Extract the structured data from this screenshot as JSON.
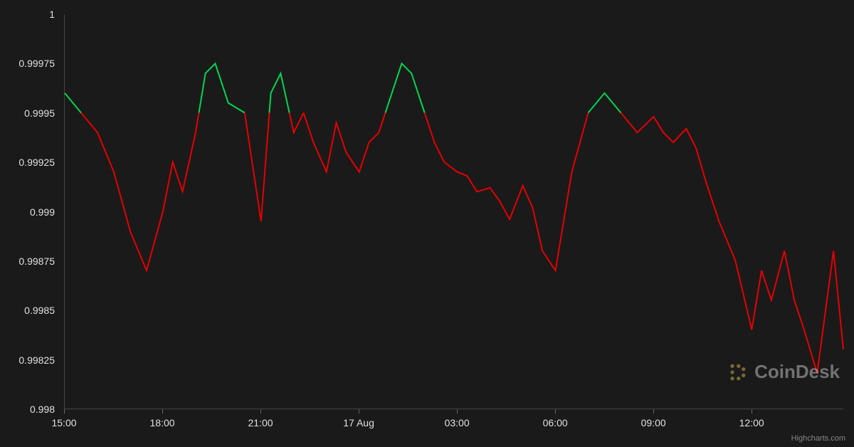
{
  "chart_data": {
    "type": "line",
    "title": "",
    "xlabel": "",
    "ylabel": "",
    "ylim": [
      0.998,
      1.0
    ],
    "x_ticks": [
      "15:00",
      "18:00",
      "21:00",
      "17 Aug",
      "03:00",
      "06:00",
      "09:00",
      "12:00"
    ],
    "y_ticks": [
      0.998,
      0.99825,
      0.9985,
      0.99875,
      0.999,
      0.99925,
      0.9995,
      0.99975,
      1.0
    ],
    "threshold": 0.9995,
    "color_above": "#00d64f",
    "color_below": "#e60000",
    "series": [
      {
        "name": "price",
        "x": [
          0,
          0.5,
          1,
          1.5,
          2,
          2.5,
          3,
          3.3,
          3.6,
          4,
          4.3,
          4.6,
          5,
          5.5,
          6,
          6.3,
          6.6,
          7,
          7.3,
          7.6,
          8,
          8.3,
          8.6,
          9,
          9.3,
          9.6,
          10,
          10.3,
          10.6,
          11,
          11.3,
          11.6,
          12,
          12.3,
          12.6,
          13,
          13.3,
          13.6,
          14,
          14.3,
          14.6,
          15,
          15.5,
          16,
          16.5,
          17,
          17.5,
          18,
          18.3,
          18.6,
          19,
          19.3,
          19.6,
          20,
          20.5,
          21,
          21.3,
          21.6,
          22,
          22.3,
          22.6,
          23,
          23.5,
          23.8
        ],
        "values": [
          0.9996,
          0.9995,
          0.9994,
          0.9992,
          0.9989,
          0.9987,
          0.999,
          0.99925,
          0.9991,
          0.9994,
          0.9997,
          0.99975,
          0.99955,
          0.9995,
          0.99895,
          0.9996,
          0.9997,
          0.9994,
          0.9995,
          0.99935,
          0.9992,
          0.99945,
          0.9993,
          0.9992,
          0.99935,
          0.9994,
          0.9996,
          0.99975,
          0.9997,
          0.9995,
          0.99935,
          0.99925,
          0.9992,
          0.99918,
          0.9991,
          0.99912,
          0.99905,
          0.99896,
          0.99913,
          0.99902,
          0.9988,
          0.9987,
          0.9992,
          0.9995,
          0.9996,
          0.9995,
          0.9994,
          0.99948,
          0.9994,
          0.99935,
          0.99942,
          0.99932,
          0.99915,
          0.99895,
          0.99875,
          0.9984,
          0.9987,
          0.99855,
          0.9988,
          0.99855,
          0.9984,
          0.99818,
          0.9988,
          0.9983
        ]
      }
    ]
  },
  "y_axis": {
    "labels": [
      "0.998",
      "0.99825",
      "0.9985",
      "0.99875",
      "0.999",
      "0.99925",
      "0.9995",
      "0.99975",
      "1"
    ]
  },
  "x_axis": {
    "labels": [
      "15:00",
      "18:00",
      "21:00",
      "17 Aug",
      "03:00",
      "06:00",
      "09:00",
      "12:00"
    ]
  },
  "watermark": {
    "text": "CoinDesk"
  },
  "credit": {
    "text": "Highcharts.com"
  }
}
